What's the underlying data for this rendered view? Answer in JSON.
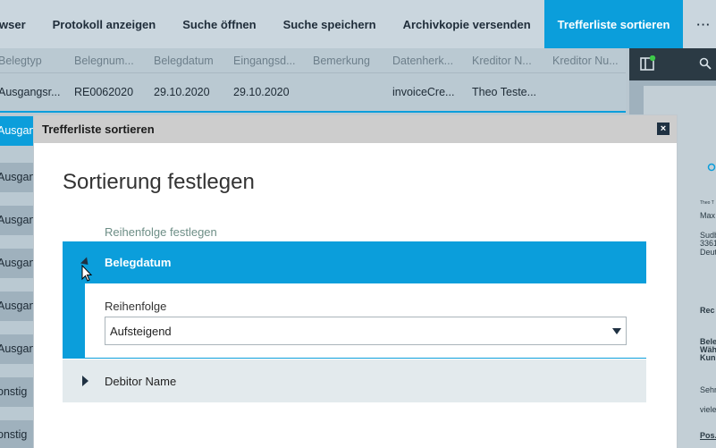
{
  "toolbar": {
    "items": [
      {
        "label": "wser"
      },
      {
        "label": "Protokoll anzeigen"
      },
      {
        "label": "Suche öffnen"
      },
      {
        "label": "Suche speichern"
      },
      {
        "label": "Archivkopie versenden"
      },
      {
        "label": "Trefferliste sortieren"
      }
    ],
    "more": "···"
  },
  "grid": {
    "columns": [
      "Belegtyp",
      "Belegnum...",
      "Belegdatum",
      "Eingangsd...",
      "Bemerkung",
      "Datenherk...",
      "Kreditor N...",
      "Kreditor Nu..."
    ],
    "row": [
      "Ausgangsr...",
      "RE0062020",
      "29.10.2020",
      "29.10.2020",
      "",
      "invoiceCre...",
      "Theo Teste...",
      ""
    ],
    "side_tabs": [
      "Ausgan",
      "Ausgan",
      "Ausgan",
      "Ausgan",
      "Ausgan",
      "Ausgan",
      "onstig",
      "onstig"
    ]
  },
  "preview": {
    "lines": [
      "Theo T",
      "Max",
      "Sudb",
      "3361",
      "Deut",
      "Rec",
      "Bele",
      "Wäh",
      "Kun",
      "Sehr",
      "viele",
      "Pos."
    ]
  },
  "dialog": {
    "title": "Trefferliste sortieren",
    "close": "×",
    "heading": "Sortierung festlegen",
    "section_label": "Reihenfolge festlegen",
    "expanded": {
      "header": "Belegdatum",
      "field_label": "Reihenfolge",
      "select_value": "Aufsteigend"
    },
    "collapsed": {
      "header": "Debitor Name"
    }
  },
  "colors": {
    "accent": "#0b9edb",
    "toolbar_bg": "#cad6de",
    "dark": "#1f3142"
  }
}
